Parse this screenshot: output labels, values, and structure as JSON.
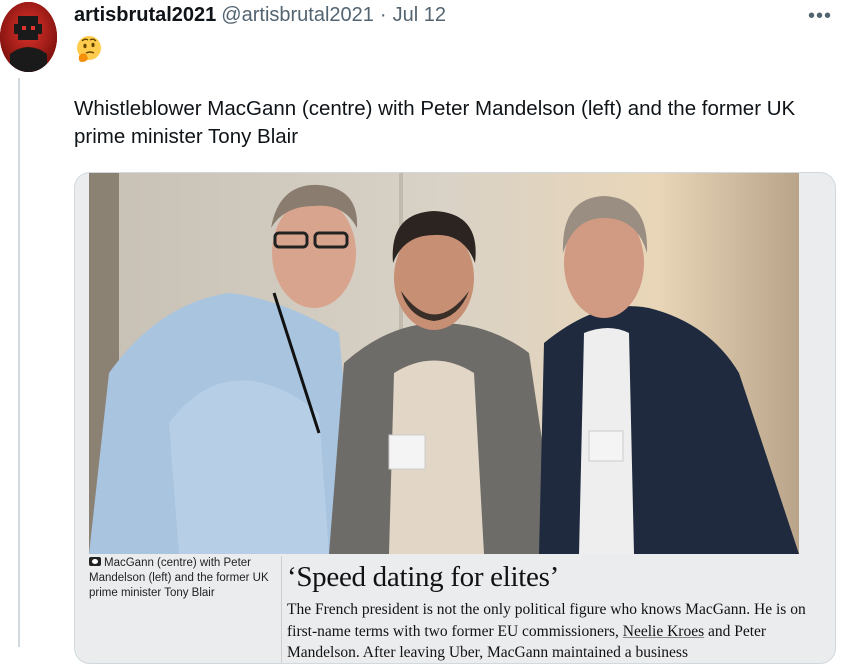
{
  "tweet": {
    "display_name": "artisbrutal2021",
    "handle": "@artisbrutal2021",
    "separator": "·",
    "date": "Jul 12",
    "more_label": "•••",
    "emoji_icon": "thinking-face",
    "text": "Whistleblower MacGann (centre) with Peter Mandelson (left) and the former UK prime minister Tony Blair"
  },
  "card": {
    "caption": "MacGann (centre) with Peter Mandelson (left) and the former UK prime minister Tony Blair",
    "headline": "‘Speed dating for elites’",
    "body_start": "The French president is not the only political figure who knows MacGann. He is on first-name terms with two former EU commissioners, ",
    "link_text": "Neelie Kroes",
    "body_end": " and Peter Mandelson. After leaving Uber, MacGann maintained a business"
  },
  "colors": {
    "text": "#0f1419",
    "muted": "#536471",
    "border": "#cfd9de",
    "avatar_bg": "#c0201b"
  }
}
